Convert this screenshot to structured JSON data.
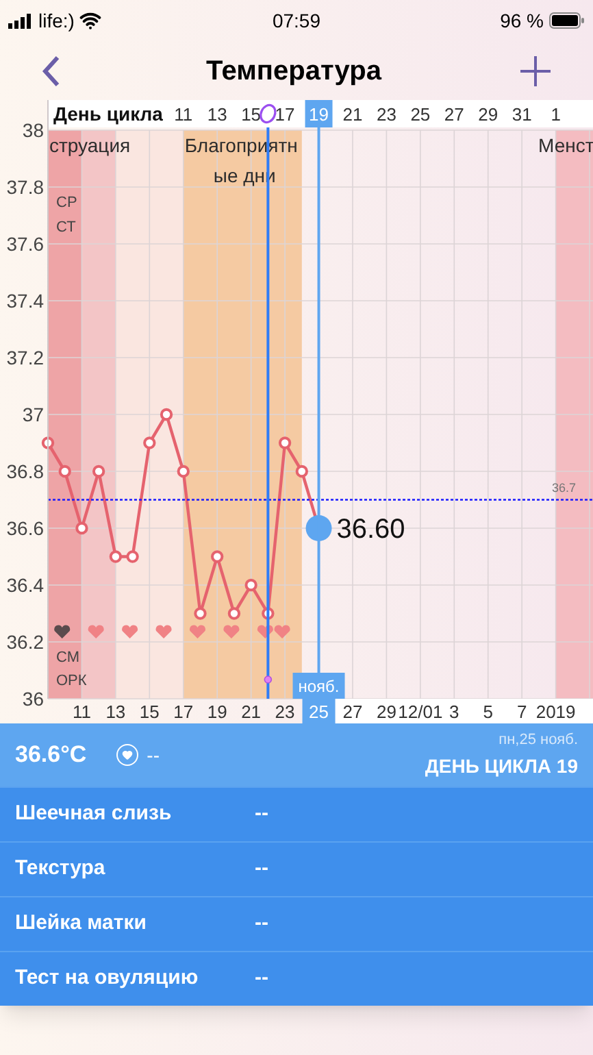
{
  "status_bar": {
    "carrier": "life:)",
    "time": "07:59",
    "battery": "96 %"
  },
  "nav": {
    "title": "Температура"
  },
  "chart": {
    "axis_title": "День цикла",
    "top_labels": [
      {
        "text": "11",
        "selected": false
      },
      {
        "text": "13",
        "selected": false
      },
      {
        "text": "15",
        "selected": false
      },
      {
        "text": "17",
        "selected": false
      },
      {
        "text": "19",
        "selected": true
      },
      {
        "text": "21",
        "selected": false
      },
      {
        "text": "23",
        "selected": false
      },
      {
        "text": "25",
        "selected": false
      },
      {
        "text": "27",
        "selected": false
      },
      {
        "text": "29",
        "selected": false
      },
      {
        "text": "31",
        "selected": false
      },
      {
        "text": "1",
        "selected": false
      }
    ],
    "next_month_labels": [
      "12/01",
      "3",
      "5",
      "7",
      "2019"
    ],
    "month_badge": "нояб.",
    "point_label": "36.60",
    "coverline_label": "36.7",
    "notes_top": [
      "СР",
      "СТ"
    ],
    "notes_bottom": [
      "СМ",
      "ОРК"
    ],
    "phases": [
      {
        "kind": "menstruation",
        "color": "#eea4a6"
      },
      {
        "kind": "menstruation_light",
        "color": "#f3c5c6"
      },
      {
        "kind": "pre_fertile",
        "color": "#fae6e0"
      },
      {
        "kind": "fertile",
        "color": "#f5caa2"
      },
      {
        "kind": "ovulation",
        "color": "#f5caa3"
      },
      {
        "kind": "next_menstruation",
        "color": "#f4bcc1"
      }
    ],
    "days": [
      {
        "kind": "menstruation",
        "lines": [
          "струация"
        ]
      },
      {
        "kind": "menstruation",
        "color": "#5b4b4d"
      },
      {
        "kind": "menstruation_light"
      },
      {
        "kind": "menstruation_light",
        "color": "#f08285"
      },
      {
        "kind": "pre_fertile"
      },
      {
        "kind": "pre_fertile",
        "color": "#f08285"
      },
      {
        "kind": "pre_fertile"
      },
      {
        "kind": "pre_fertile",
        "color": "#f08285"
      },
      {
        "kind": "fertile",
        "lines": [
          "Благоприятн",
          "ые дни"
        ]
      },
      {
        "kind": "fertile",
        "color": "#f08285"
      },
      {
        "kind": "fertile"
      },
      {
        "kind": "fertile",
        "color": "#f08285"
      },
      {
        "kind": "fertile"
      },
      {
        "kind": "ovulation",
        "color": "#f08285"
      },
      {
        "kind": "fertile",
        "color": "#f08285"
      },
      {
        "kind": "none"
      },
      {
        "kind": "cursor"
      },
      {
        "kind": "none"
      },
      {
        "kind": "none"
      },
      {
        "kind": "none"
      },
      {
        "kind": "none"
      },
      {
        "kind": "none"
      },
      {
        "kind": "none"
      },
      {
        "kind": "none"
      },
      {
        "kind": "none"
      },
      {
        "kind": "none"
      },
      {
        "kind": "none"
      },
      {
        "kind": "none"
      },
      {
        "kind": "none"
      },
      {
        "kind": "none"
      },
      {
        "kind": "next_menstruation",
        "lines": [
          "Менст"
        ]
      },
      {
        "kind": "next_menstruation"
      },
      {
        "kind": "next_menstruation"
      }
    ],
    "chart_data": {
      "type": "line",
      "grid": true,
      "x": [
        9,
        10,
        11,
        12,
        13,
        14,
        15,
        16,
        17,
        18,
        19,
        20,
        21,
        22,
        23,
        24,
        25
      ],
      "xlim": [
        9,
        41.2
      ],
      "ylim": [
        36,
        38
      ],
      "xticks": [
        {
          "value": 11,
          "label": "11"
        },
        {
          "value": 13,
          "label": "13"
        },
        {
          "value": 15,
          "label": "15"
        },
        {
          "value": 17,
          "label": "17"
        },
        {
          "value": 19,
          "label": "19"
        },
        {
          "value": 21,
          "label": "21"
        },
        {
          "value": 23,
          "label": "23"
        },
        {
          "value": 25,
          "label": "25"
        },
        {
          "value": 27,
          "label": "27"
        },
        {
          "value": 29,
          "label": "29"
        }
      ],
      "yticks": [
        {
          "value": 38,
          "label": "38"
        },
        {
          "value": 37.8,
          "label": "37.8"
        },
        {
          "value": 37.6,
          "label": "37.6"
        },
        {
          "value": 37.4,
          "label": "37.4"
        },
        {
          "value": 37.2,
          "label": "37.2"
        },
        {
          "value": 37,
          "label": "37"
        },
        {
          "value": 36.8,
          "label": "36.8"
        },
        {
          "value": 36.6,
          "label": "36.6"
        },
        {
          "value": 36.4,
          "label": "36.4"
        },
        {
          "value": 36.2,
          "label": "36.2"
        },
        {
          "value": 36,
          "label": "36"
        }
      ],
      "series": [
        {
          "color": "#e5636e",
          "marker": "circle",
          "values": [
            36.9,
            36.8,
            36.6,
            36.8,
            36.5,
            36.5,
            36.9,
            37.0,
            36.8,
            36.3,
            36.5,
            36.3,
            36.4,
            36.3,
            36.9,
            36.8,
            36.6
          ]
        }
      ]
    }
  },
  "panel": {
    "temperature": "36.6°C",
    "mood": "--",
    "date": "пн,25 нояб.",
    "cycle_day": "ДЕНЬ ЦИКЛА 19",
    "rows": [
      {
        "label": "Шеечная слизь",
        "value": "--"
      },
      {
        "label": "Текстура",
        "value": "--"
      },
      {
        "label": "Шейка матки",
        "value": "--"
      },
      {
        "label": "Тест на овуляцию",
        "value": "--"
      }
    ]
  }
}
